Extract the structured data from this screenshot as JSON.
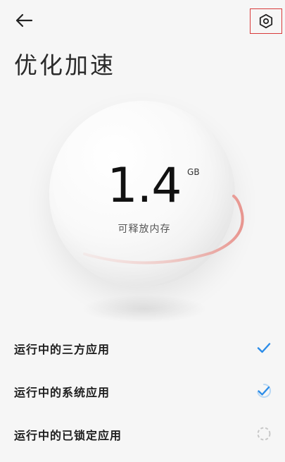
{
  "header": {
    "back_icon": "back-arrow-icon",
    "settings_icon": "hexagon-settings-icon"
  },
  "title": "优化加速",
  "memory": {
    "value": "1.4",
    "unit": "GB",
    "label": "可释放内存"
  },
  "options": [
    {
      "label": "运行中的三方应用",
      "state": "checked"
    },
    {
      "label": "运行中的系统应用",
      "state": "checked-partial"
    },
    {
      "label": "运行中的已锁定应用",
      "state": "loading"
    }
  ],
  "colors": {
    "accent": "#2b8ce8",
    "ring": "#e8958f",
    "highlight_border": "#d83a3a"
  }
}
